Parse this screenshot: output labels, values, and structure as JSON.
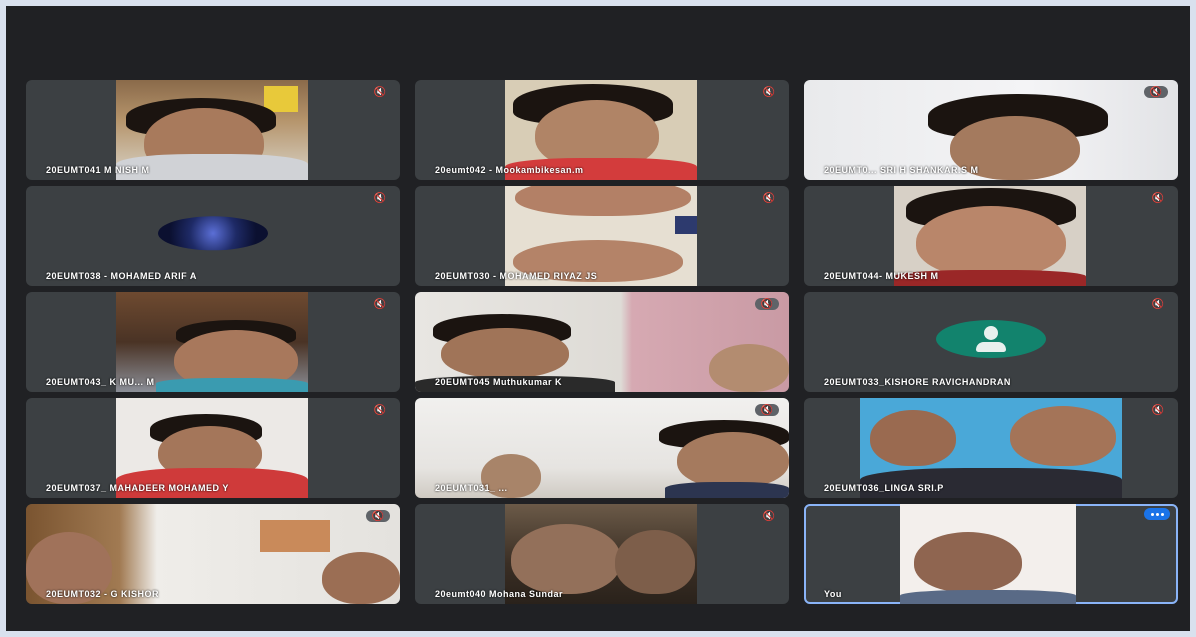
{
  "meeting": {
    "participants": [
      {
        "name": "20EUMT041 M NISH M",
        "mute_icon": "mic-off-icon"
      },
      {
        "name": "20eumt042 - Mookambikesan.m",
        "mute_icon": "mic-off-icon"
      },
      {
        "name": "20EUMT0... SRI H SHANKAR.S M",
        "mute_icon": "mic-off-icon"
      },
      {
        "name": "20EUMT038 - MOHAMED ARIF A",
        "mute_icon": "mic-off-icon"
      },
      {
        "name": "20EUMT030 - MOHAMED RIYAZ JS",
        "mute_icon": "mic-off-icon"
      },
      {
        "name": "20EUMT044- MUKESH M",
        "mute_icon": "mic-off-icon"
      },
      {
        "name": "20EUMT043_ K MU... M",
        "mute_icon": "mic-off-icon"
      },
      {
        "name": "20EUMT045 Muthukumar K",
        "mute_icon": "mic-off-icon"
      },
      {
        "name": "20EUMT033_KISHORE RAVICHANDRAN",
        "mute_icon": "mic-off-icon"
      },
      {
        "name": "20EUMT037_ MAHADEER MOHAMED Y",
        "mute_icon": "mic-off-icon"
      },
      {
        "name": "20EUMT031_ ...",
        "mute_icon": "mic-off-icon"
      },
      {
        "name": "20EUMT036_LINGA SRI.P",
        "mute_icon": "mic-off-icon"
      },
      {
        "name": "20EUMT032 - G KISHOR",
        "mute_icon": "mic-off-icon"
      },
      {
        "name": "20eumt040 Mohana Sundar",
        "mute_icon": "mic-off-icon"
      },
      {
        "name": "You",
        "mute_icon": "more-options-icon"
      }
    ]
  },
  "colors": {
    "background": "#202124",
    "tile": "#3c4043",
    "self_highlight": "#8ab4f8",
    "avatar_green": "#12836d"
  }
}
